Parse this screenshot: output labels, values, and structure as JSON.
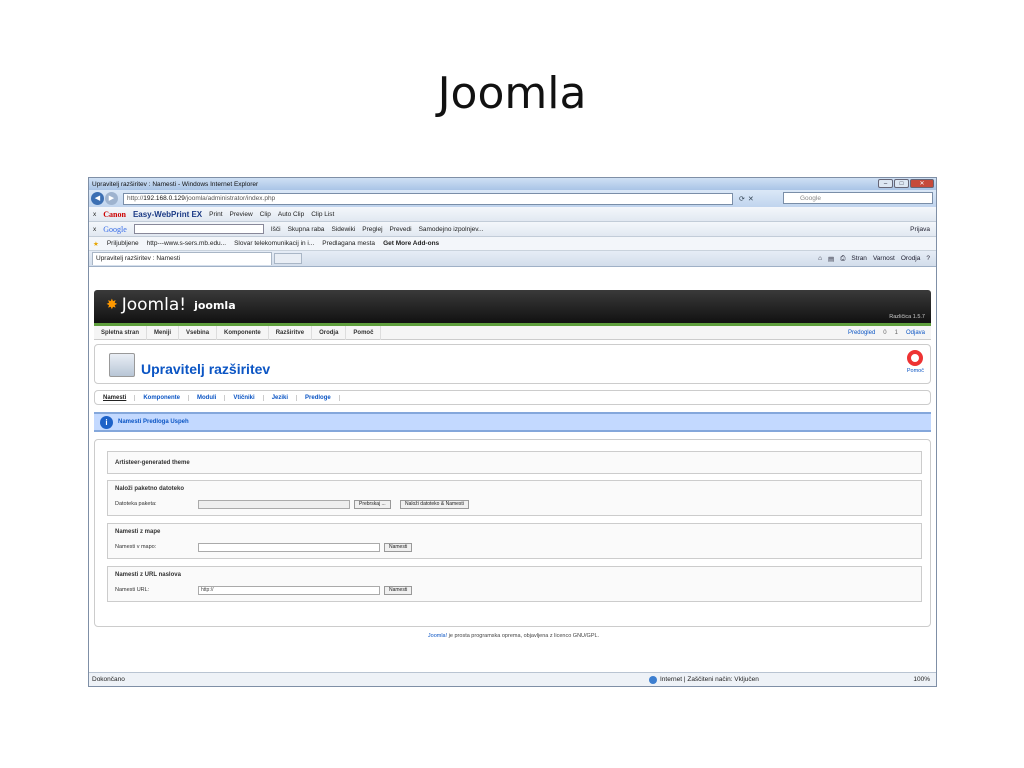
{
  "slide": {
    "title": "Joomla"
  },
  "browser": {
    "window_title": "Upravitelj razširitev : Namesti - Windows Internet Explorer",
    "address_prefix": "http://",
    "address_host": "192.168.0.129",
    "address_path": "/joomla/administrator/index.php",
    "search_placeholder": "Google",
    "canon_toolbar": {
      "brand": "Canon",
      "product": "Easy-WebPrint EX",
      "items": [
        "Print",
        "Preview",
        "Clip",
        "Auto Clip",
        "Clip List"
      ]
    },
    "google_toolbar": {
      "brand": "Google",
      "items": [
        "Išči",
        "Skupna raba",
        "Sidewiki",
        "Preglej",
        "Prevedi",
        "Samodejno izpolnjev..."
      ],
      "signin": "Prijava"
    },
    "favorites": {
      "label": "Priljubljene",
      "items": [
        "http---www.s-sers.mb.edu...",
        "Slovar telekomunikacij in i...",
        "Predlagana mesta",
        "Get More Add-ons"
      ]
    },
    "tab_title": "Upravitelj razširitev : Namesti",
    "command_bar": [
      "Stran",
      "Varnost",
      "Orodja"
    ],
    "status": {
      "left": "Dokončano",
      "zone": "Internet | Zaščiteni način: Vključen",
      "zoom": "100%"
    }
  },
  "joomla": {
    "logo": "Joomla!",
    "site_name": "joomla",
    "version": "Različica 1.5.7",
    "menu": [
      "Spletna stran",
      "Meniji",
      "Vsebina",
      "Komponente",
      "Razširitve",
      "Orodja",
      "Pomoč"
    ],
    "status": {
      "preview": "Predogled",
      "messages": "0",
      "users": "1",
      "logout": "Odjava"
    },
    "page_title": "Upravitelj razširitev",
    "help": "Pomoč",
    "subnav": [
      "Namesti",
      "Komponente",
      "Moduli",
      "Vtičniki",
      "Jeziki",
      "Predloge"
    ],
    "message": "Namesti Predloga Uspeh",
    "theme_box": "Artisteer-generated theme",
    "upload": {
      "legend": "Naloži paketno datoteko",
      "label": "Datoteka paketa:",
      "browse": "Prebrskaj ...",
      "submit": "Naloži datoteko & Namesti"
    },
    "dir": {
      "legend": "Namesti z mape",
      "label": "Namesti v mapo:",
      "submit": "Namesti"
    },
    "url": {
      "legend": "Namesti z URL naslova",
      "label": "Namesti URL:",
      "value": "http://",
      "submit": "Namesti"
    },
    "footer_link": "Joomla!",
    "footer_text": " je prosta programska oprema, objavljena z licenco GNU/GPL."
  }
}
